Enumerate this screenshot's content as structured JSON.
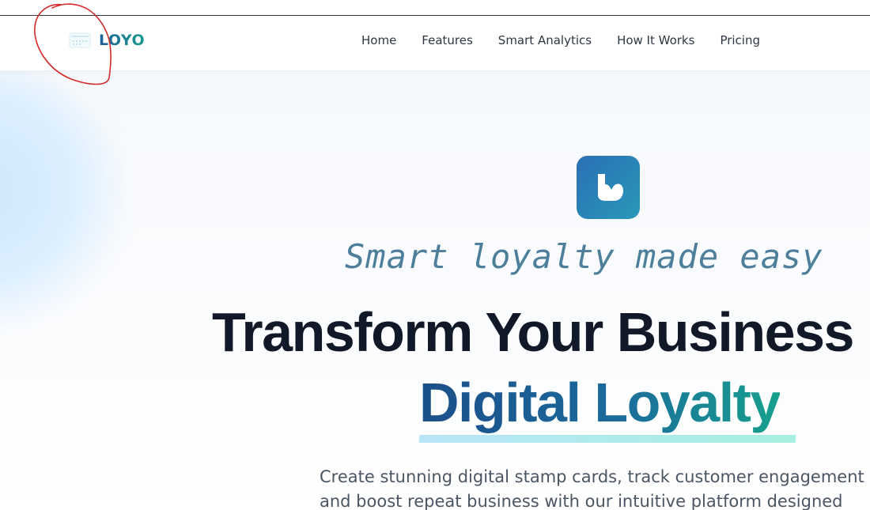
{
  "brand": {
    "name": "LOYO",
    "logo_icon": "stamp-card-logo-icon"
  },
  "nav": {
    "items": [
      {
        "label": "Home"
      },
      {
        "label": "Features"
      },
      {
        "label": "Smart Analytics"
      },
      {
        "label": "How It Works"
      },
      {
        "label": "Pricing"
      }
    ]
  },
  "hero": {
    "app_icon": "loyo-app-icon",
    "tagline": "Smart loyalty made easy",
    "headline_line1": "Transform Your Business",
    "headline_line2": "Digital Loyalty",
    "subtitle_line1": "Create stunning digital stamp cards, track customer engagement",
    "subtitle_line2": "and boost repeat business with our intuitive platform designed"
  },
  "annotation": {
    "type": "red-circle-markup"
  },
  "colors": {
    "accent_start": "#1d5f98",
    "accent_end": "#1a9b8f",
    "headline": "#111827",
    "tagline": "#4d7f9b",
    "annotation_red": "#d42a2a"
  }
}
